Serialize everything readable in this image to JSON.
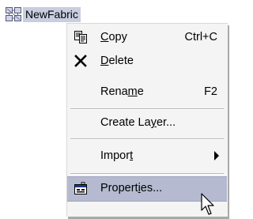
{
  "tree": {
    "node_label": "NewFabric",
    "node_icon": "fabric-icon"
  },
  "menu": {
    "copy": {
      "pre": "",
      "ul": "C",
      "post": "opy",
      "shortcut": "Ctrl+C",
      "icon": "copy-icon"
    },
    "delete": {
      "pre": "",
      "ul": "D",
      "post": "elete",
      "icon": "delete-x-icon"
    },
    "rename": {
      "pre": "Rena",
      "ul": "m",
      "post": "e",
      "shortcut": "F2"
    },
    "create_layer": {
      "pre": "Create La",
      "ul": "y",
      "post": "er..."
    },
    "import": {
      "pre": "Impor",
      "ul": "t",
      "post": "",
      "icon": "submenu-arrow-icon"
    },
    "properties": {
      "pre": "Propert",
      "ul": "i",
      "post": "es...",
      "icon": "properties-icon",
      "highlighted": true
    }
  },
  "colors": {
    "menu_background": "#f4f4f4",
    "highlight": "#b5bad0",
    "selected_node": "#c8cde0"
  }
}
